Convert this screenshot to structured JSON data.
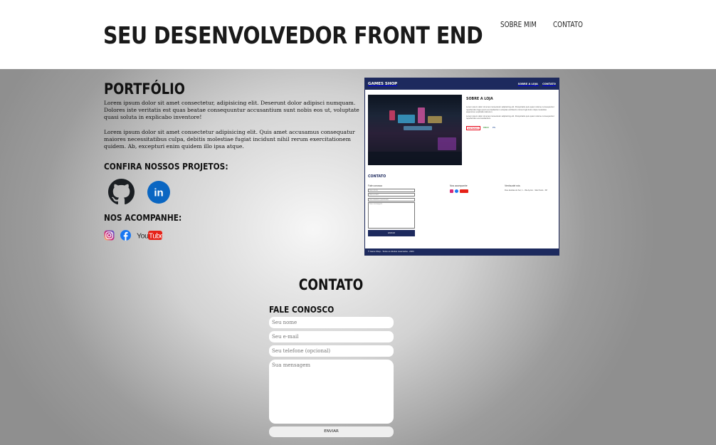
{
  "header": {
    "title": "SEU DESENVOLVEDOR FRONT END",
    "nav": [
      "SOBRE MIM",
      "CONTATO"
    ]
  },
  "portfolio": {
    "title": "PORTFÓLIO",
    "paragraphs": [
      "Lorem ipsum dolor sit amet consectetur, adipisicing elit. Deserunt dolor adipisci numquam. Dolores iste veritatis est quas beatae consequuntur accusantium sunt nobis eos ut, voluptate quasi soluta in explicabo inventore!",
      "Lorem ipsum dolor sit amet consectetur adipisicing elit. Quis amet accusamus consequatur maiores necessitatibus culpa, debitis molestiae fugiat incidunt nihil rerum exercitationem quidem. Ab, excepturi enim quidem illo ipsa atque."
    ],
    "projects_title": "CONFIRA NOSSOS PROJETOS:",
    "projects_icons": [
      "github-icon",
      "linkedin-icon"
    ],
    "follow_title": "NOS ACOMPANHE:",
    "social_icons": [
      "instagram-icon",
      "facebook-icon",
      "youtube-icon"
    ],
    "youtube_label": "YouTube",
    "linkedin_label": "in"
  },
  "project_preview": {
    "brand": "GAMES SHOP",
    "nav": [
      "SOBRE A LOJA",
      "CONTATO"
    ],
    "about_title": "SOBRE A LOJA",
    "about_text_1": "Lorem ipsum dolor sit amet consectetur adipisicing elit. Perspiciatis quis quam ratione consequuntur repellendus fuga quod eos laudantium voluptas architecto minus fugit dolor culpa molestias asperiores explicabo laborum.",
    "about_text_2": "Lorem ipsum dolor sit amet consectetur adipisicing elit. Perspiciatis quis quam ratione consequuntur repellendus eos laudantium.",
    "badges": [
      "NINTENDO",
      "XBOX",
      "PS"
    ],
    "contact_title": "CONTATO",
    "col1_title": "Fale conosco",
    "fields": [
      "Seu nome",
      "Seu e-mail",
      "Seu telefone (opcional)",
      "Sua mensagem"
    ],
    "send": "ENVIAR",
    "col2_title": "Nos acompanhe",
    "col3_title": "Venha até nós",
    "address": "Rua Jandaia do Sul, 1 - Vila Aprico - São Paulo - SP",
    "footer": "© Game Shop - Todos os direitos reservados - 2024"
  },
  "contact": {
    "title": "CONTATO",
    "form_title": "FALE CONOSCO",
    "name_placeholder": "Seu nome",
    "email_placeholder": "Seu e-mail",
    "phone_placeholder": "Seu telefone (opcional)",
    "message_placeholder": "Sua mensagem",
    "send_label": "ENVIAR"
  },
  "colors": {
    "preview_navy": "#1d2a5e",
    "github": "#1b1f23",
    "linkedin": "#0a66c2",
    "facebook": "#1877f2",
    "youtube": "#e62117"
  }
}
